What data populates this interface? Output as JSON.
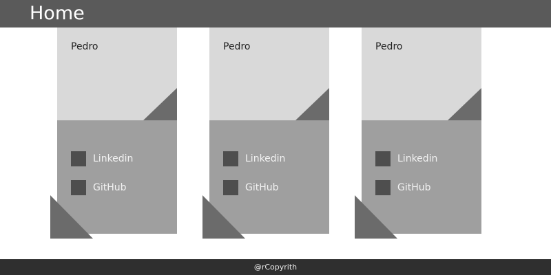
{
  "header": {
    "title": "Home"
  },
  "cards": [
    {
      "name": "Pedro",
      "links": [
        {
          "icon": "linkedin-icon",
          "label": "Linkedin"
        },
        {
          "icon": "github-icon",
          "label": "GitHub"
        }
      ]
    },
    {
      "name": "Pedro",
      "links": [
        {
          "icon": "linkedin-icon",
          "label": "Linkedin"
        },
        {
          "icon": "github-icon",
          "label": "GitHub"
        }
      ]
    },
    {
      "name": "Pedro",
      "links": [
        {
          "icon": "linkedin-icon",
          "label": "Linkedin"
        },
        {
          "icon": "github-icon",
          "label": "GitHub"
        }
      ]
    }
  ],
  "footer": {
    "text": "@rCopyrith"
  },
  "colors": {
    "header_bg": "#5a5a5a",
    "card_top_bg": "#d9d9d9",
    "card_bottom_bg": "#9f9f9f",
    "accent_shape": "#6b6b6b",
    "footer_bg": "#2f2f2f"
  }
}
